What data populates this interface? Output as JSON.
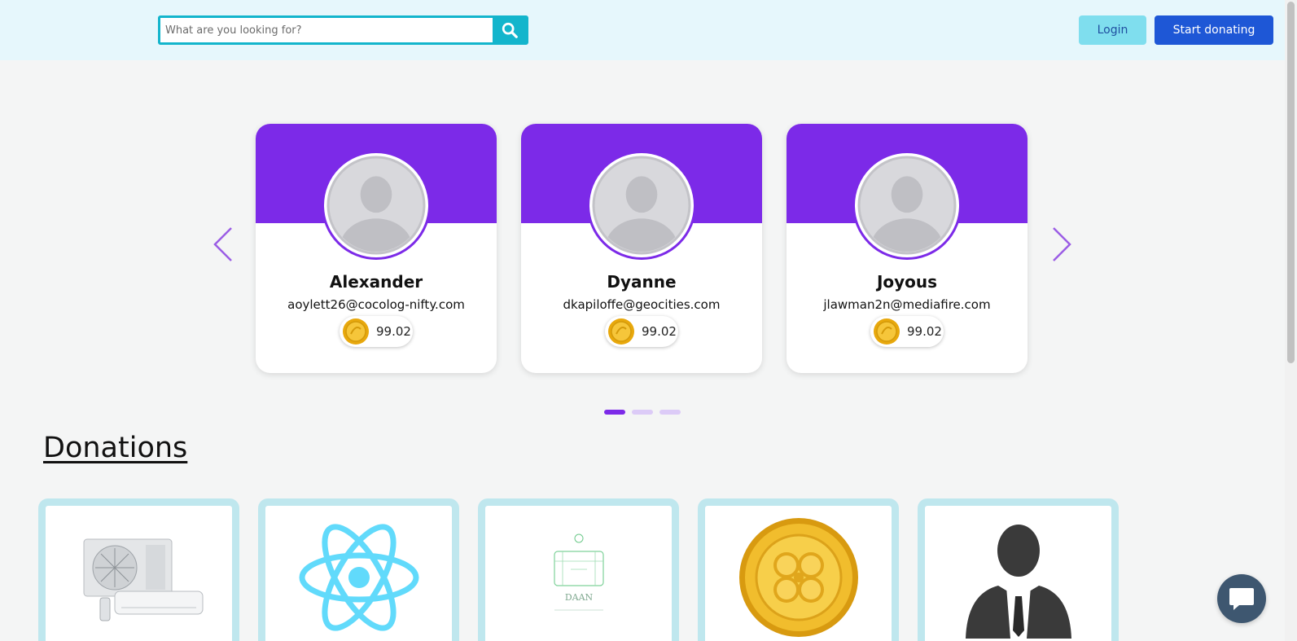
{
  "header": {
    "search_placeholder": "What are you looking for?",
    "login_label": "Login",
    "donate_label": "Start donating"
  },
  "carousel": {
    "cards": [
      {
        "name": "Alexander",
        "email": "aoylett26@cocolog-nifty.com",
        "coins": "99.02"
      },
      {
        "name": "Dyanne",
        "email": "dkapiloffe@geocities.com",
        "coins": "99.02"
      },
      {
        "name": "Joyous",
        "email": "jlawman2n@mediafire.com",
        "coins": "99.02"
      }
    ],
    "page_count": 3,
    "active_page": 1
  },
  "donations": {
    "title": "Donations",
    "items": [
      {
        "image": "air-conditioner-image"
      },
      {
        "image": "react-logo-image"
      },
      {
        "image": "daan-logo-image",
        "logo_text": "DAAN"
      },
      {
        "image": "gold-coin-image"
      },
      {
        "image": "businessman-silhouette-image"
      }
    ]
  },
  "colors": {
    "accent_purple": "#7c2ae8",
    "search_teal": "#13b5cc",
    "login_bg": "#7fdeee",
    "donate_bg": "#1e57d6",
    "header_bg": "#e6f7fc",
    "card_border": "#bfe7ee",
    "chat_bg": "#3e5770"
  }
}
